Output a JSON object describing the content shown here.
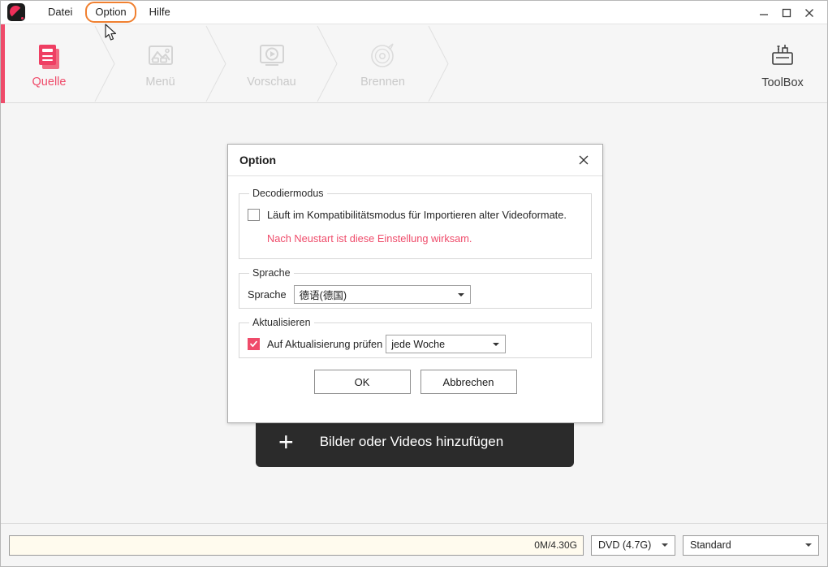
{
  "window": {
    "app_icon": "disc-app-icon",
    "controls": {
      "minimize": "minimize-icon",
      "maximize": "maximize-icon",
      "close": "close-icon"
    }
  },
  "menubar": {
    "items": [
      {
        "label": "Datei",
        "highlighted": false
      },
      {
        "label": "Option",
        "highlighted": true
      },
      {
        "label": "Hilfe",
        "highlighted": false
      }
    ]
  },
  "toolbar": {
    "steps": [
      {
        "label": "Quelle",
        "icon": "document-pages-icon",
        "active": true
      },
      {
        "label": "Menü",
        "icon": "image-picture-icon",
        "active": false
      },
      {
        "label": "Vorschau",
        "icon": "play-monitor-icon",
        "active": false
      },
      {
        "label": "Brennen",
        "icon": "disc-burn-icon",
        "active": false
      }
    ],
    "toolbox": {
      "label": "ToolBox",
      "icon": "toolbox-icon"
    },
    "accent_color": "#ef4b6a"
  },
  "workarea": {
    "add_media_button": {
      "label": "Bilder oder Videos hinzufügen",
      "plus_icon": "plus-icon"
    }
  },
  "statusbar": {
    "capacity_text": "0M/4.30G",
    "disc_select": {
      "value": "DVD (4.7G)"
    },
    "quality_select": {
      "value": "Standard"
    }
  },
  "dialog": {
    "title": "Option",
    "close_icon": "close-icon",
    "groups": {
      "decoder": {
        "legend": "Decodiermodus",
        "checkbox": {
          "label": "Läuft im Kompatibilitätsmodus für Importieren alter Videoformate.",
          "checked": false
        },
        "hint": "Nach Neustart ist diese Einstellung wirksam.",
        "hint_color": "#ef4b6a"
      },
      "language": {
        "legend": "Sprache",
        "field_label": "Sprache",
        "select_value": "德语(德国)"
      },
      "update": {
        "legend": "Aktualisieren",
        "checkbox": {
          "label": "Auf Aktualisierung prüfen",
          "checked": true
        },
        "select_value": "jede Woche"
      }
    },
    "buttons": {
      "ok": "OK",
      "cancel": "Abbrechen"
    }
  }
}
